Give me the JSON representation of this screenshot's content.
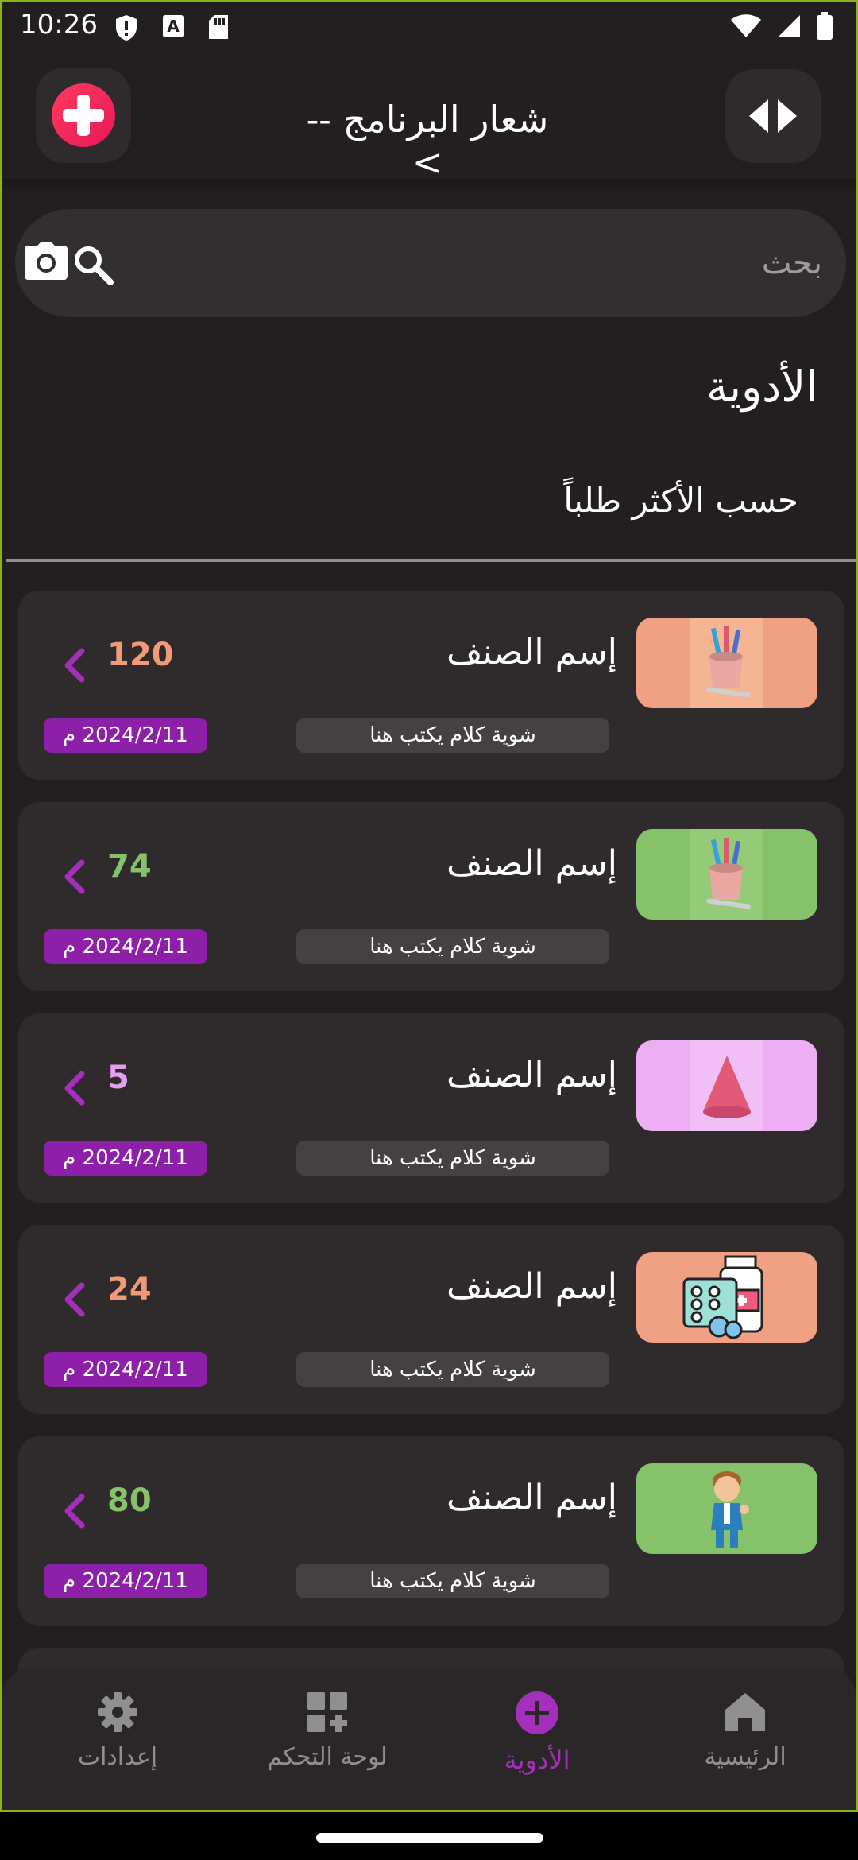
{
  "status_bar": {
    "time": "10:26",
    "icons": [
      "shield-alert-icon",
      "a-box-icon",
      "sd-card-icon",
      "wifi-icon",
      "signal-icon",
      "battery-icon"
    ]
  },
  "header": {
    "title": "شعار البرنامج -->",
    "logo_icon": "medical-cross-icon",
    "right_icon": "code-arrows-icon"
  },
  "search": {
    "placeholder": "بحث",
    "value": "",
    "icons": [
      "camera-icon",
      "search-icon"
    ]
  },
  "section": {
    "title": "الأدوية",
    "subtitle": "حسب الأكثر طلباً"
  },
  "items": [
    {
      "name": "إسم الصنف",
      "count": "120",
      "desc": "شوية كلام يكتب هنا",
      "date": "2024/2/11 م",
      "thumb_bg": "#f0a183",
      "thumb_inner": "#f5b492",
      "count_color": "#f29a77",
      "image": "pencil-cup-image"
    },
    {
      "name": "إسم الصنف",
      "count": "74",
      "desc": "شوية كلام يكتب هنا",
      "date": "2024/2/11 م",
      "thumb_bg": "#86c26a",
      "thumb_inner": "#93cb77",
      "count_color": "#86c26a",
      "image": "pencil-cup-image"
    },
    {
      "name": "إسم الصنف",
      "count": "5",
      "desc": "شوية كلام يكتب هنا",
      "date": "2024/2/11 م",
      "thumb_bg": "#eeaef4",
      "thumb_inner": "#f2bef6",
      "count_color": "#e69ef0",
      "image": "cone-image"
    },
    {
      "name": "إسم الصنف",
      "count": "24",
      "desc": "شوية كلام يكتب هنا",
      "date": "2024/2/11 م",
      "thumb_bg": "#f0a183",
      "thumb_inner": "#f0a183",
      "count_color": "#f29a77",
      "image": "medicine-bottle-image"
    },
    {
      "name": "إسم الصنف",
      "count": "80",
      "desc": "شوية كلام يكتب هنا",
      "date": "2024/2/11 م",
      "thumb_bg": "#86c26a",
      "thumb_inner": "#86c26a",
      "count_color": "#86c26a",
      "image": "doctor-image"
    }
  ],
  "bottom_nav": [
    {
      "label": "إعدادات",
      "icon": "gear-icon",
      "active": false
    },
    {
      "label": "لوحة التحكم",
      "icon": "dashboard-add-icon",
      "active": false
    },
    {
      "label": "الأدوية",
      "icon": "plus-circle-icon",
      "active": true
    },
    {
      "label": "الرئيسية",
      "icon": "home-icon",
      "active": false
    }
  ],
  "colors": {
    "background": "#231f20",
    "card": "#2f2a2b",
    "accent": "#8e1fa8",
    "active_nav": "#a230bb",
    "border": "#8bb21d"
  }
}
